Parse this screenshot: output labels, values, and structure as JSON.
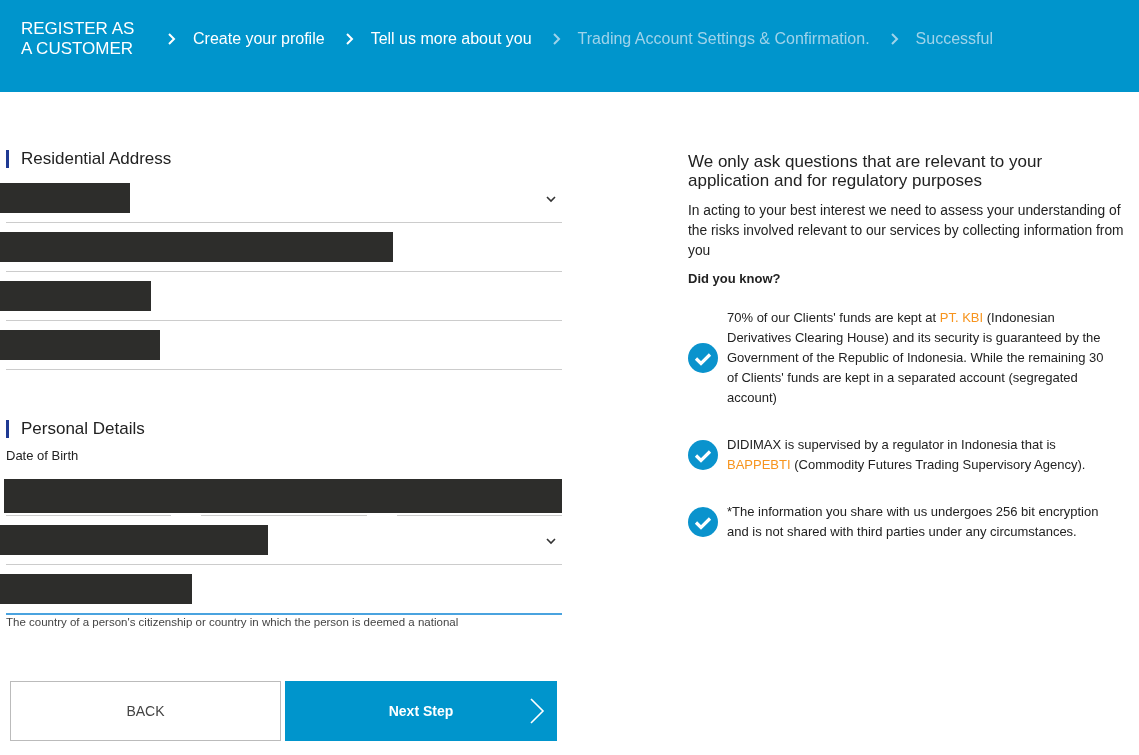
{
  "header": {
    "title": "REGISTER AS A CUSTOMER",
    "steps": [
      {
        "label": "Create your profile",
        "active": true
      },
      {
        "label": "Tell us more about you",
        "active": true
      },
      {
        "label": "Trading Account Settings & Confirmation.",
        "active": false
      },
      {
        "label": "Successful",
        "active": false
      }
    ]
  },
  "residential_address": {
    "heading": "Residential Address",
    "fields": [
      {
        "kind": "select",
        "focused": false
      },
      {
        "kind": "text",
        "focused": false
      },
      {
        "kind": "text",
        "focused": false
      },
      {
        "kind": "text",
        "focused": false
      }
    ]
  },
  "personal_details": {
    "heading": "Personal Details",
    "date_label": "Date of Birth",
    "fields": [
      {
        "kind": "date",
        "focused": false
      },
      {
        "kind": "select",
        "focused": false
      },
      {
        "kind": "text",
        "focused": true,
        "hint": "The country of a person's citizenship or country in which the person is deemed a national"
      }
    ]
  },
  "buttons": [
    {
      "label": "BACK",
      "kind": "secondary"
    },
    {
      "label": "Next Step",
      "kind": "primary"
    }
  ],
  "info": {
    "title": "We only ask questions that are relevant to your application and for regulatory purposes",
    "intro": "In acting to your best interest we need to assess your understanding of the risks involved relevant to our services by collecting information from you",
    "did_you_know": "Did you know?",
    "facts": [
      {
        "parts": [
          {
            "text": "70% of our Clients' funds are kept at ",
            "link": false
          },
          {
            "text": "PT. KBI",
            "link": true
          },
          {
            "text": " (Indonesian Derivatives Clearing House) and its security is guaranteed by the Government of the Republic of Indonesia. While the remaining 30",
            "link": false
          },
          {
            "text": "of Clients' funds are kept in a separated account (segregated account)",
            "link": false,
            "new_line": true
          }
        ]
      },
      {
        "parts": [
          {
            "text": "DIDIMAX is supervised by a regulator in Indonesia that is ",
            "link": false
          },
          {
            "text": "BAPPEBTI",
            "link": true
          },
          {
            "text": " (Commodity Futures Trading Supervisory Agency).",
            "link": false
          }
        ]
      },
      {
        "parts": [
          {
            "text": "*The information you share with us undergoes 256 bit encryption and is not shared with third parties under any circumstances.",
            "link": false
          }
        ]
      }
    ]
  }
}
